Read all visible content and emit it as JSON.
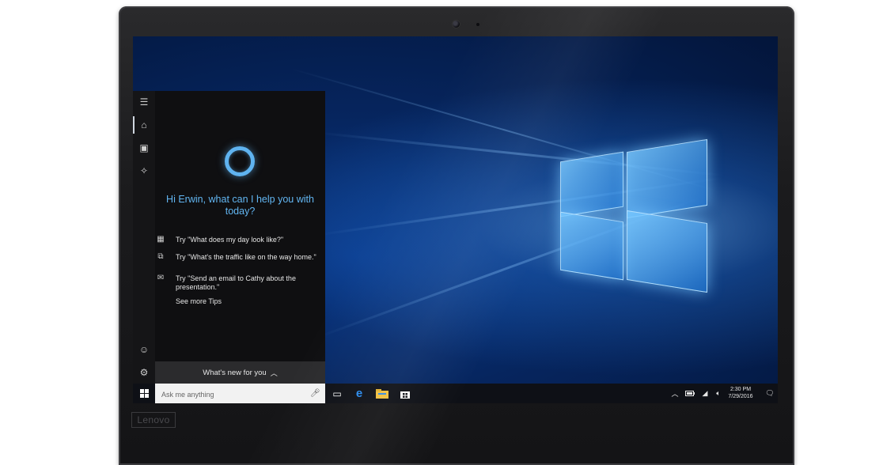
{
  "device": {
    "brand": "Lenovo"
  },
  "cortana": {
    "greeting": "Hi Erwin, what can I help you with today?",
    "tips": [
      {
        "icon": "calendar-icon",
        "text": "Try \"What does my day look like?\""
      },
      {
        "icon": "traffic-icon",
        "text": "Try \"What's the traffic like on the way home.\""
      },
      {
        "icon": "mail-icon",
        "text": "Try \"Send an email to Cathy about the presentation.\""
      }
    ],
    "see_more": "See more Tips",
    "whats_new": "What's new for you",
    "rail": [
      "menu-icon",
      "home-icon",
      "notebook-icon",
      "lightbulb-icon",
      "feedback-icon",
      "settings-icon"
    ]
  },
  "taskbar": {
    "search_placeholder": "Ask me anything",
    "apps": [
      "task-view-icon",
      "edge-browser-icon",
      "file-explorer-icon",
      "store-icon"
    ],
    "tray": [
      "chevron-up-icon",
      "battery-icon",
      "wifi-icon",
      "volume-icon"
    ],
    "time": "2:30 PM",
    "date": "7/29/2016"
  },
  "colors": {
    "accent": "#5fb3f0",
    "panel": "#0f0f11",
    "taskbar": "#0e1016"
  }
}
